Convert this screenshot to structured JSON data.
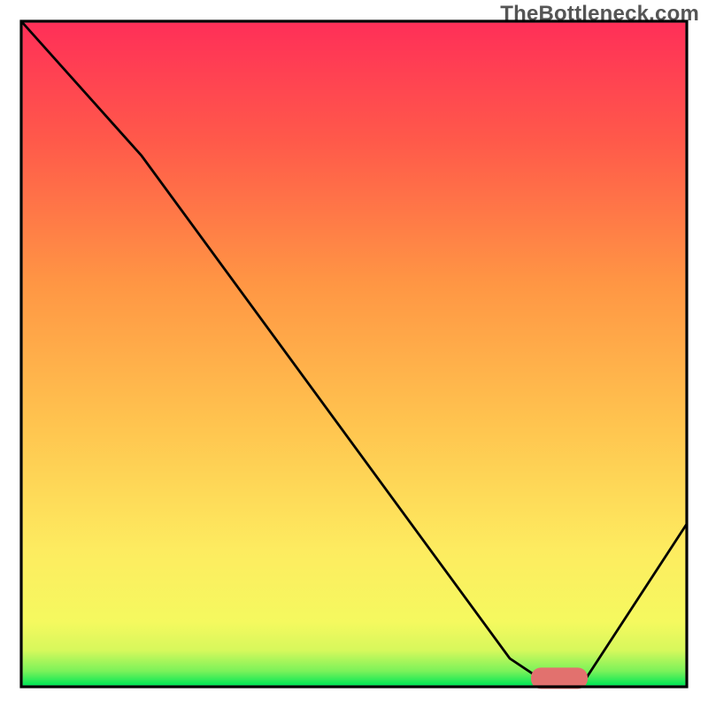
{
  "watermark": "TheBottleneck.com",
  "chart_data": {
    "type": "line",
    "title": "",
    "xlabel": "",
    "ylabel": "",
    "xlim": [
      0,
      100
    ],
    "ylim": [
      0,
      100
    ],
    "grid": false,
    "legend": false,
    "background_gradient": {
      "y_range": [
        3,
        97
      ],
      "stops": [
        {
          "y": 3,
          "color": "#00e756"
        },
        {
          "y": 5,
          "color": "#7af25a"
        },
        {
          "y": 8,
          "color": "#d7f85c"
        },
        {
          "y": 12,
          "color": "#f5f95f"
        },
        {
          "y": 22,
          "color": "#fdec60"
        },
        {
          "y": 40,
          "color": "#ffc44f"
        },
        {
          "y": 60,
          "color": "#ff9644"
        },
        {
          "y": 80,
          "color": "#ff5a4a"
        },
        {
          "y": 97,
          "color": "#ff2f58"
        }
      ]
    },
    "axes_box": {
      "x0": 3,
      "y0": 3,
      "x1": 97,
      "y1": 97
    },
    "series": [
      {
        "name": "curve",
        "color": "#000000",
        "stroke_width": 2.8,
        "x": [
          3,
          20,
          72,
          78,
          82,
          97
        ],
        "y": [
          97,
          78,
          7,
          3,
          3,
          26
        ]
      }
    ],
    "marker": {
      "shape": "rounded-rect",
      "x_center": 79,
      "y": 4.2,
      "width": 8,
      "height": 3,
      "fill": "#e2716e",
      "rx": 1.4
    }
  }
}
